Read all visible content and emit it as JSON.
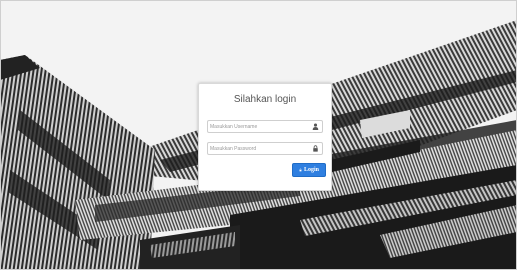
{
  "login": {
    "title": "Silahkan login",
    "username": {
      "value": "",
      "placeholder": "Masukkan Username",
      "icon": "user-icon"
    },
    "password": {
      "value": "",
      "placeholder": "Masukkan Password",
      "icon": "lock-icon"
    },
    "button": {
      "label": "Login",
      "icon": "lock-icon",
      "color": "#2f7fe0"
    }
  },
  "background": {
    "sky": "#f2f2f2",
    "building_dark": "#1a1a1a"
  }
}
